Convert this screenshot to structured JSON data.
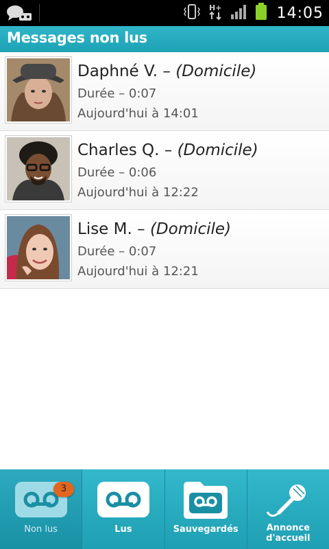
{
  "status_bar": {
    "time": "14:05",
    "network": "H+",
    "icons": [
      "messages-icon",
      "vibrate-icon",
      "network-h-plus-icon",
      "signal-icon",
      "battery-icon"
    ]
  },
  "header": {
    "title": "Messages non lus"
  },
  "messages": [
    {
      "name": "Daphné V.",
      "place": "(Domicile)",
      "duration": "Durée – 0:07",
      "date": "Aujourd'hui à 14:01"
    },
    {
      "name": "Charles Q.",
      "place": "(Domicile)",
      "duration": "Durée – 0:06",
      "date": "Aujourd'hui à 12:22"
    },
    {
      "name": "Lise M.",
      "place": "(Domicile)",
      "duration": "Durée – 0:07",
      "date": "Aujourd'hui à 12:21"
    }
  ],
  "tabs": [
    {
      "label": "Non lus",
      "badge": "3",
      "icon": "voicemail-icon"
    },
    {
      "label": "Lus",
      "icon": "voicemail-icon"
    },
    {
      "label": "Sauvegardés",
      "icon": "saved-folder-icon"
    },
    {
      "label": "Annonce d'accueil",
      "icon": "microphone-icon"
    }
  ],
  "colors": {
    "accent": "#1ea2b6",
    "badge": "#e2661f"
  }
}
